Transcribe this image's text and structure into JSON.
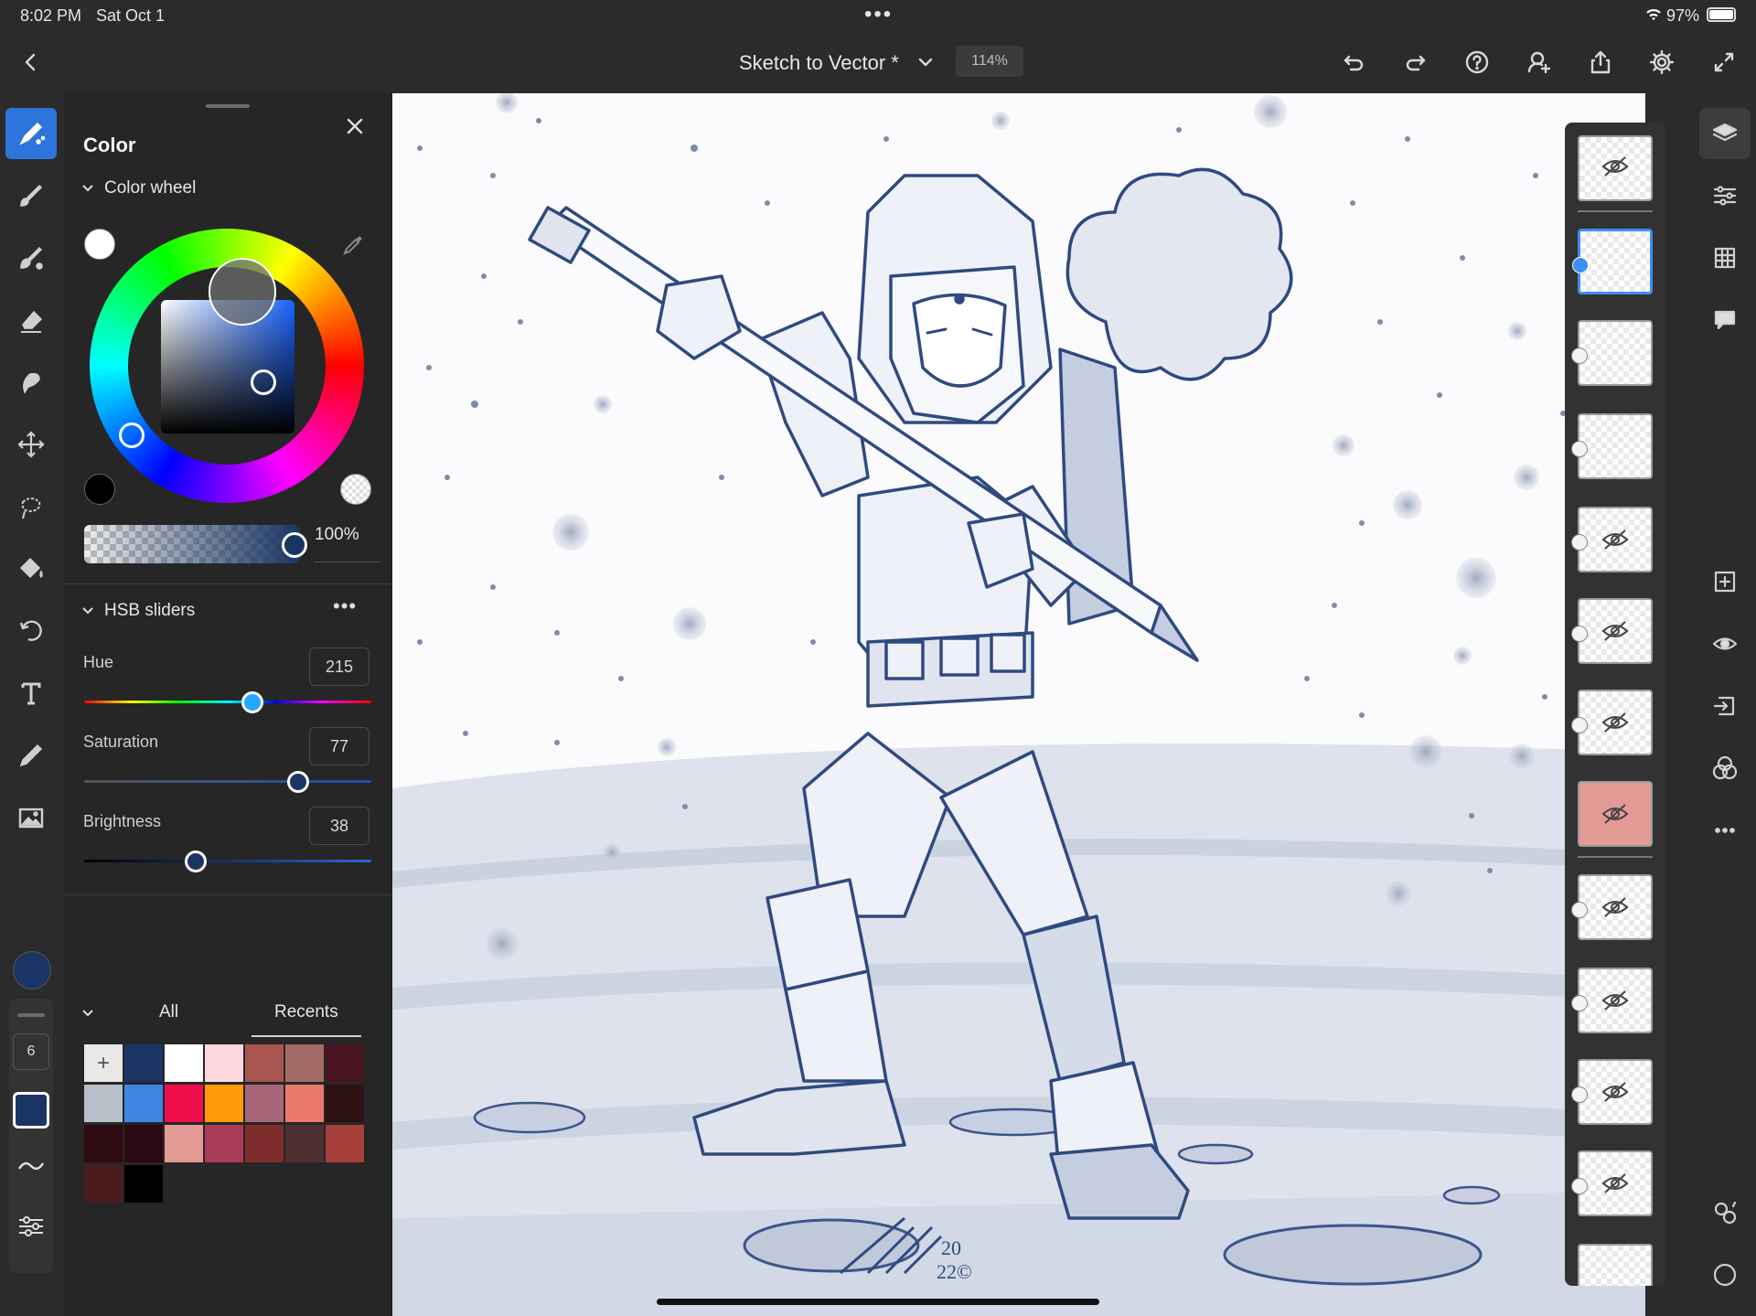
{
  "status_bar": {
    "time": "8:02 PM",
    "date": "Sat Oct 1",
    "dots": "•••",
    "battery": "97%"
  },
  "title_bar": {
    "title": "Sketch to Vector *",
    "zoom": "114%"
  },
  "color_panel": {
    "title": "Color",
    "color_wheel_label": "Color wheel",
    "opacity": "100%",
    "hsb_label": "HSB sliders",
    "more": "•••",
    "hue": {
      "label": "Hue",
      "value": "215",
      "fraction": 0.59
    },
    "saturation": {
      "label": "Saturation",
      "value": "77",
      "fraction": 0.75
    },
    "brightness": {
      "label": "Brightness",
      "value": "38",
      "fraction": 0.39
    },
    "tabs": {
      "all": "All",
      "recents": "Recents"
    },
    "add_symbol": "+",
    "swatches": [
      "#1a3563",
      "#ffffff",
      "#fdd6e0",
      "#a8564f",
      "#a46b66",
      "#4a1420",
      "#b7bfc9",
      "#3f86e4",
      "#ee0f4c",
      "#ff9a0a",
      "#a96678",
      "#ea7a6e",
      "#2e1212",
      "#2e0b12",
      "#2b0812",
      "#e39a95",
      "#a83b57",
      "#7e2c2c",
      "#4e2f31",
      "#a7403a",
      "#4a1b1b",
      "#000000"
    ]
  },
  "colors": {
    "accent": "#2d74db",
    "current_color": "#1a3563",
    "canvas_bg": "#fbfbfd",
    "sketch_blue": "#2f4a80"
  },
  "left_toolbar": {
    "brush_size": "6"
  },
  "icons": [
    "back-arrow-icon",
    "chevron-down-icon",
    "undo-icon",
    "redo-icon",
    "help-icon",
    "invite-icon",
    "share-icon",
    "gear-icon",
    "fullscreen-icon",
    "layers-icon",
    "adjustments-icon",
    "grid-icon",
    "comment-icon",
    "add-layer-icon",
    "visibility-icon",
    "import-icon",
    "blend-icon",
    "more-icon",
    "eyedropper-icon",
    "close-icon"
  ]
}
